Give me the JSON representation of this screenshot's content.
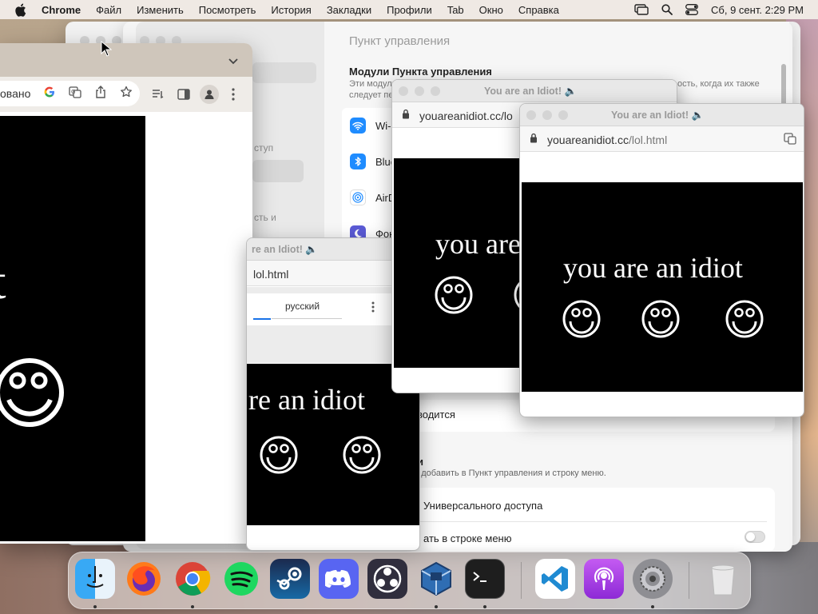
{
  "menubar": {
    "app_name": "Chrome",
    "items": [
      "Файл",
      "Изменить",
      "Посмотреть",
      "История",
      "Закладки",
      "Профили",
      "Tab",
      "Окно",
      "Справка"
    ],
    "clock": "Сб, 9 сент.  2:29 PM"
  },
  "settings": {
    "title": "Пункт управления",
    "section_title": "Модули Пункта управления",
    "desc_left": "Эти модули",
    "desc_left2": "следует пе",
    "desc_right": "ость, когда их также",
    "sidebar_text_1": "ступ",
    "sidebar_text_2": "сть и",
    "modules": [
      {
        "label": "Wi-",
        "icon": "wifi-icon",
        "color": "#1f8cff"
      },
      {
        "label": "Blue",
        "icon": "bluetooth-icon",
        "color": "#1f8cff"
      },
      {
        "label": "AirD",
        "icon": "airdrop-icon",
        "color": "#ffffff"
      },
      {
        "label": "Фок",
        "icon": "focus-moon-icon",
        "color": "#5b5bd6"
      }
    ],
    "row_vvoditsya": "водится",
    "row_other_title": "и",
    "row_other_desc": "но добавить в Пункт управления и строку меню.",
    "row_accessibility": "Универсального доступа",
    "row_show_menu": "ать в строке меню"
  },
  "chrome_left": {
    "url_fragment": "овано",
    "page_text": "iot"
  },
  "popup_center": {
    "title": "re an Idiot! 🔈",
    "url": "lol.html",
    "translate_tab": "русский",
    "page_text": "re an idiot"
  },
  "popup_mid": {
    "title": "You are an Idiot! 🔈",
    "url": "youareanidiot.cc/lo",
    "page_text": "you are"
  },
  "popup_right": {
    "title": "You are an Idiot! 🔈",
    "url_domain": "youareanidiot.cc",
    "url_path": "/lol.html",
    "page_text": "you are an idiot"
  },
  "dock": {
    "apps": [
      "Finder",
      "Firefox",
      "Chrome",
      "Spotify",
      "Steam",
      "Discord",
      "OBS",
      "VirtualBox",
      "Terminal",
      "VS Code",
      "Podcasts",
      "System Settings",
      "Trash"
    ]
  }
}
